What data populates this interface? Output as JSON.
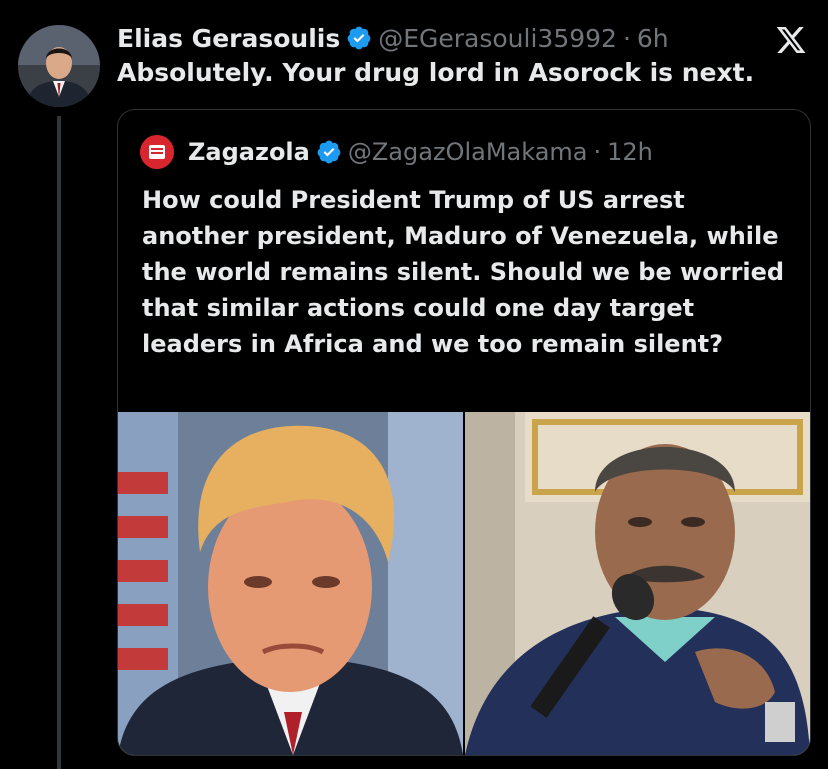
{
  "tweet": {
    "author_name": "Elias Gerasoulis",
    "handle": "@EGerasouli35992",
    "separator": "·",
    "time": "6h",
    "text": "Absolutely. Your drug lord in Asorock is next."
  },
  "quoted_tweet": {
    "author_name": "Zagazola",
    "handle": "@ZagazOlaMakama",
    "separator": "·",
    "time": "12h",
    "text": "How could President Trump of US arrest another president, Maduro of Venezuela, while the world remains silent. Should we be worried that similar actions could one day target leaders in Africa and we too remain silent?"
  },
  "icons": {
    "verified": "verified-badge-icon",
    "platform": "x-logo-icon"
  },
  "colors": {
    "background": "#000000",
    "text": "#e7e9ea",
    "muted": "#71767b",
    "verified": "#1d9bf0",
    "border": "#2f3336"
  }
}
